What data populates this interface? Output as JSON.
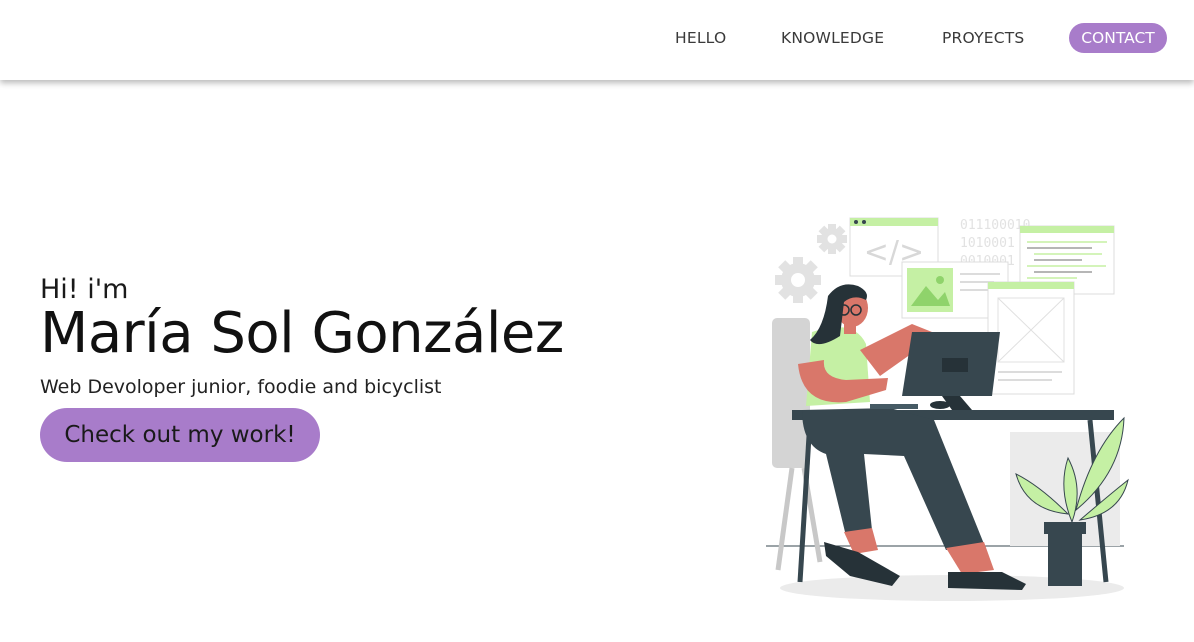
{
  "nav": {
    "links": [
      {
        "label": "HELLO"
      },
      {
        "label": "KNOWLEDGE"
      },
      {
        "label": "PROYECTS"
      }
    ],
    "contact_label": "CONTACT"
  },
  "hero": {
    "greeting": "Hi! i'm",
    "name": "María Sol González",
    "tagline": "Web Devoloper junior, foodie and bicyclist",
    "cta_label": "Check out my work!"
  },
  "illustration": {
    "binary_lines": [
      "011100010",
      "1010001",
      "0010001"
    ],
    "colors": {
      "accent_green": "#c5f0a4",
      "dark": "#37474f",
      "skin": "#d9776a",
      "gray": "#ebebeb"
    }
  },
  "colors": {
    "brand_purple": "#a87cca",
    "nav_text": "#3a3a3a"
  }
}
